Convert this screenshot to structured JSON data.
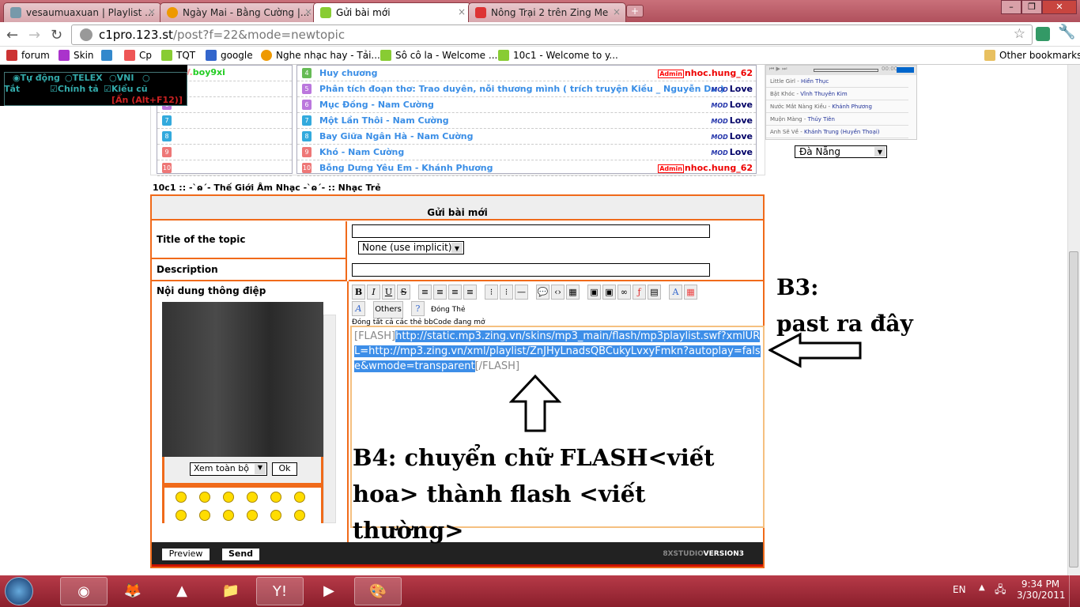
{
  "browser": {
    "tabs": [
      {
        "label": "vesaumuaxuan | Playlist ...",
        "active": false,
        "icon": "disc-icon"
      },
      {
        "label": "Ngày Mai - Bằng Cường |...",
        "active": false,
        "icon": "zing-mp3-icon"
      },
      {
        "label": "Gửi bài mới",
        "active": true,
        "icon": "speech-bubble-icon"
      },
      {
        "label": "Nông Trại 2 trên Zing Me",
        "active": false,
        "icon": "zing-me-icon"
      }
    ],
    "url_host": "c1pro.123.st",
    "url_path": "/post?f=22&mode=newtopic",
    "bookmarks": [
      {
        "label": "forum",
        "color": "#c33"
      },
      {
        "label": "Skin",
        "color": "#a3c"
      },
      {
        "label": "",
        "color": "#38c"
      },
      {
        "label": "Cp",
        "color": "#e55"
      },
      {
        "label": "TQT",
        "color": "#8c3"
      },
      {
        "label": "google",
        "color": "#36c"
      },
      {
        "label": "Nghe nhạc hay - Tải...",
        "color": "#e90"
      },
      {
        "label": "Sô cô la - Welcome ...",
        "color": "#8c3"
      },
      {
        "label": "10c1 - Welcome to y...",
        "color": "#8c3"
      }
    ],
    "other_bookmarks": "Other bookmarks"
  },
  "ime": {
    "opt_auto": "Tự động",
    "opt_telex": "TELEX",
    "opt_vni": "VNI",
    "opt_off": "Tắt",
    "chk_spell": "Chính tả",
    "chk_old": "Kiểu cũ",
    "hide": "[Ẩn (Alt+F12)]"
  },
  "left_list": [
    {
      "n": "4",
      "user": "boy9xi",
      "prefix": "TV."
    },
    {
      "n": "5"
    },
    {
      "n": "6"
    },
    {
      "n": "7"
    },
    {
      "n": "8"
    },
    {
      "n": "9"
    },
    {
      "n": "10"
    }
  ],
  "songs": [
    {
      "n": "4",
      "title": "Huy chương",
      "badge": "Admin",
      "user": "nhoc.hung_62"
    },
    {
      "n": "5",
      "title": "Phân tích đoạn thơ: Trao duyên, nỗi thương mình ( trích truyện Kiều _ Nguyễn Du )",
      "badge": "MOD",
      "user": "Love"
    },
    {
      "n": "6",
      "title": "Mục Đồng - Nam Cường",
      "badge": "MOD",
      "user": "Love"
    },
    {
      "n": "7",
      "title": "Một Lần Thôi - Nam Cường",
      "badge": "MOD",
      "user": "Love"
    },
    {
      "n": "8",
      "title": "Bay Giữa Ngân Hà - Nam Cường",
      "badge": "MOD",
      "user": "Love"
    },
    {
      "n": "9",
      "title": "Khó - Nam Cường",
      "badge": "MOD",
      "user": "Love"
    },
    {
      "n": "10",
      "title": "Bỗng Dưng Yêu Em - Khánh Phương",
      "badge": "Admin",
      "user": "nhoc.hung_62"
    }
  ],
  "player": {
    "time": "00:00",
    "tracks": [
      {
        "song": "Little Girl",
        "artist": "Hiền Thục"
      },
      {
        "song": "Bật Khóc",
        "artist": "Vĩnh Thuyên Kim"
      },
      {
        "song": "Nước Mắt Nàng Kiều",
        "artist": "Khánh Phương"
      },
      {
        "song": "Muộn Màng",
        "artist": "Thủy Tiên"
      },
      {
        "song": "Anh Sẽ Về",
        "artist": "Khánh Trung (Huyền Thoại)"
      }
    ],
    "city": "Đà Nẵng"
  },
  "breadcrumb": "10c1  :: -`ɷ´- Thế Giới Âm Nhạc -`ɷ´- :: Nhạc Trẻ",
  "form": {
    "header": "Gửi bài mới",
    "title_label": "Title of the topic",
    "title_value": "",
    "icon_select": "None (use implicit)",
    "desc_label": "Description",
    "desc_value": "",
    "body_label": "Nội dung thông điệp",
    "others": "Others",
    "close_tag": "Đóng Thẻ",
    "close_all": "Đóng tất cả các thẻ bbCode đang mở",
    "view_all": "Xem toàn bộ",
    "ok": "Ok",
    "preview": "Preview",
    "send": "Send",
    "brand": "8XSTUDIO",
    "brand2": "VERSION3"
  },
  "editor": {
    "open_tag": "[FLASH]",
    "url": "http://static.mp3.zing.vn/skins/mp3_main/flash/mp3playlist.swf?xmlURL=http://mp3.zing.vn/xml/playlist/ZnJHyLnadsQBCukyLvxyFmkn?autoplay=false&wmode=transparent",
    "close_tag": "[/FLASH]"
  },
  "annotations": {
    "b3_line1": "B3:",
    "b3_line2": "past ra đây",
    "b4": "B4: chuyển chữ FLASH<viết hoa> thành flash <viết thường>"
  },
  "tray": {
    "lang": "EN",
    "time": "9:34 PM",
    "date": "3/30/2011"
  }
}
